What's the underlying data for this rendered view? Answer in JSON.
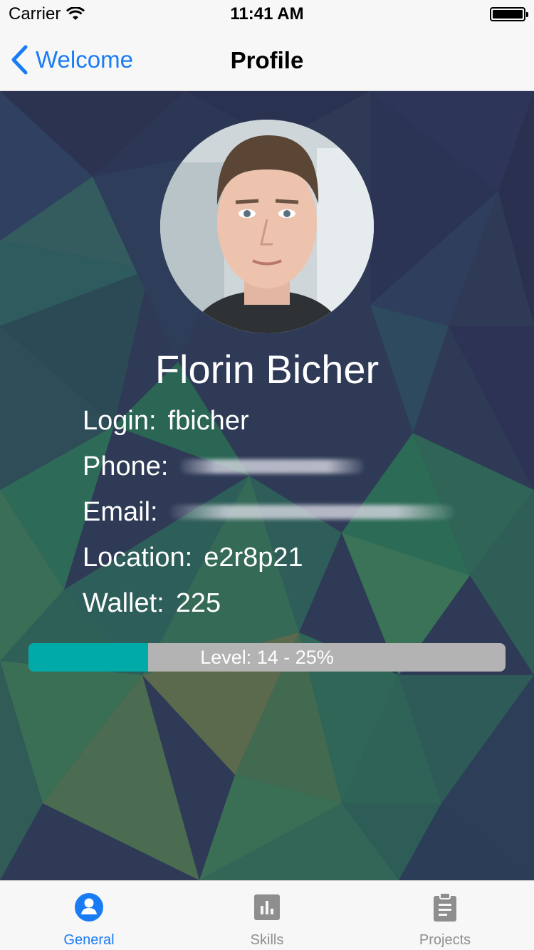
{
  "status_bar": {
    "carrier": "Carrier",
    "time": "11:41 AM"
  },
  "nav": {
    "back_label": "Welcome",
    "title": "Profile"
  },
  "profile": {
    "name": "Florin Bicher",
    "login_label": "Login:",
    "login_value": "fbicher",
    "phone_label": "Phone:",
    "email_label": "Email:",
    "location_label": "Location:",
    "location_value": "e2r8p21",
    "wallet_label": "Wallet:",
    "wallet_value": "225"
  },
  "level": {
    "text": "Level:  14 - 25%",
    "progress_fraction": 0.25
  },
  "tabs": [
    {
      "label": "General",
      "icon": "person-circle-icon",
      "active": true
    },
    {
      "label": "Skills",
      "icon": "bar-chart-icon",
      "active": false
    },
    {
      "label": "Projects",
      "icon": "clipboard-icon",
      "active": false
    }
  ],
  "colors": {
    "accent": "#1a7cf5",
    "level_fill": "#00aaa8",
    "level_track": "#b3b3b3",
    "inactive_tab": "#8e8e8e"
  }
}
